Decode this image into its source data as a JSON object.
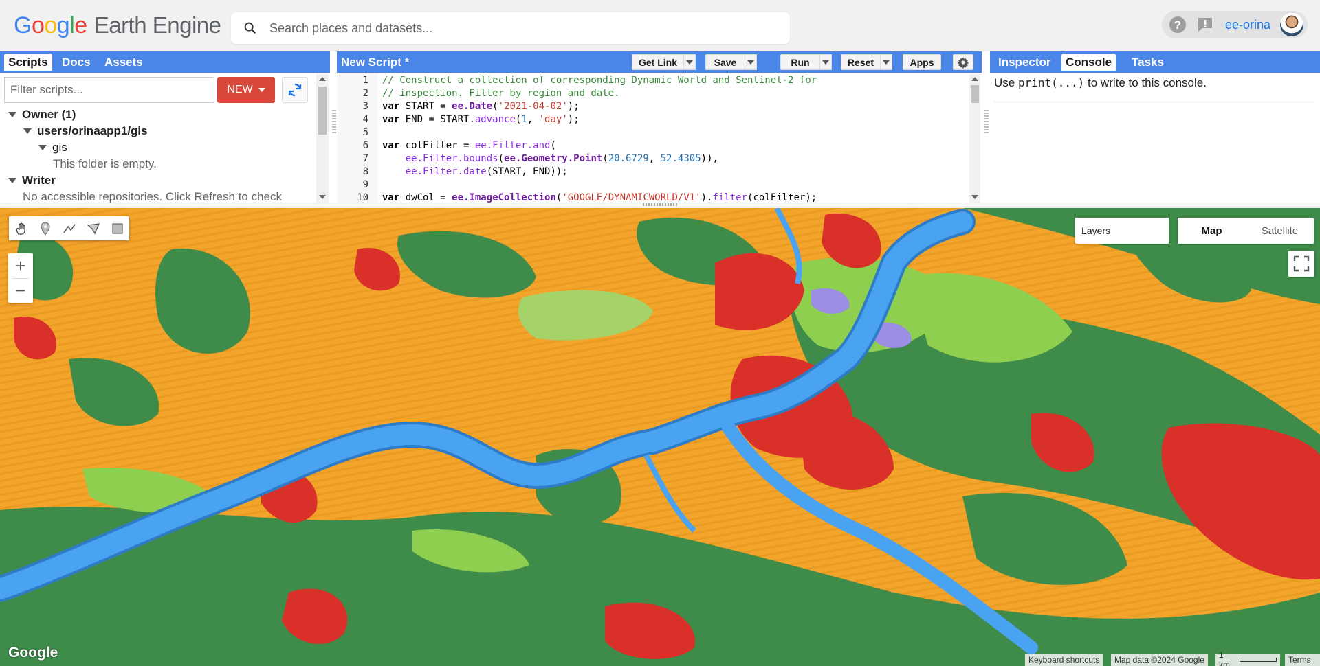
{
  "header": {
    "logo_google": [
      "G",
      "o",
      "o",
      "g",
      "l",
      "e"
    ],
    "logo_product": "Earth Engine",
    "search_placeholder": "Search places and datasets...",
    "user_name": "ee-orina"
  },
  "left_panel": {
    "tabs": [
      "Scripts",
      "Docs",
      "Assets"
    ],
    "active_tab": "Scripts",
    "filter_placeholder": "Filter scripts...",
    "new_button": "NEW",
    "tree": [
      {
        "label": "Owner (1)"
      },
      {
        "label": "users/orinaapp1/gis"
      },
      {
        "label": "gis"
      },
      {
        "label": "This folder is empty."
      },
      {
        "label": "Writer"
      },
      {
        "label": "No accessible repositories. Click Refresh to check"
      }
    ]
  },
  "editor": {
    "title": "New Script *",
    "buttons": {
      "get_link": "Get Link",
      "save": "Save",
      "run": "Run",
      "reset": "Reset",
      "apps": "Apps"
    },
    "line_numbers": [
      "1",
      "2",
      "3",
      "4",
      "5",
      "6",
      "7",
      "8",
      "9",
      "10"
    ]
  },
  "right_panel": {
    "tabs": [
      "Inspector",
      "Console",
      "Tasks"
    ],
    "active_tab": "Console",
    "message_prefix": "Use ",
    "message_code": "print(...)",
    "message_suffix": " to write to this console."
  },
  "map": {
    "layers_label": "Layers",
    "map_types": [
      "Map",
      "Satellite"
    ],
    "active_map_type": "Map",
    "zoom_in": "+",
    "zoom_out": "−",
    "watermark": "Google",
    "attribution": {
      "shortcuts": "Keyboard shortcuts",
      "map_data": "Map data ©2024 Google",
      "scale": "1 km",
      "terms": "Terms"
    },
    "drawing_tools": [
      "pan-hand-icon",
      "point-marker-icon",
      "line-icon",
      "polygon-icon",
      "rectangle-icon"
    ],
    "land_cover_colors": {
      "crops": "#f3a52b",
      "trees": "#3f8c4a",
      "built": "#d9302a",
      "grass": "#8fcf4f",
      "water": "#3f9ce8",
      "flooded_vegetation": "#9b8ee3"
    }
  }
}
